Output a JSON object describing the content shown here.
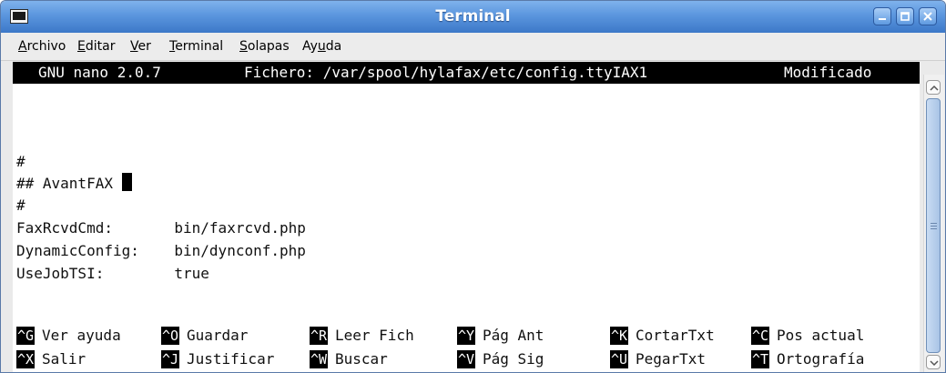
{
  "window": {
    "title": "Terminal",
    "icons": {
      "app": "terminal-icon",
      "minimize": "minimize-icon",
      "maximize": "maximize-icon",
      "close": "close-icon"
    }
  },
  "menubar": {
    "items": [
      {
        "label": "Archivo",
        "mnemonic": "A"
      },
      {
        "label": "Editar",
        "mnemonic": "E"
      },
      {
        "label": "Ver",
        "mnemonic": "V"
      },
      {
        "label": "Terminal",
        "mnemonic": "T"
      },
      {
        "label": "Solapas",
        "mnemonic": "S"
      },
      {
        "label": "Ayuda",
        "mnemonic": "u"
      }
    ]
  },
  "nano": {
    "version": "GNU nano 2.0.7",
    "file": "Fichero: /var/spool/hylafax/etc/config.ttyIAX1",
    "status": "Modificado"
  },
  "editor": {
    "lines": [
      "#",
      "## AvantFAX ",
      "#",
      "FaxRcvdCmd:       bin/faxrcvd.php",
      "DynamicConfig:    bin/dynconf.php",
      "UseJobTSI:        true"
    ]
  },
  "shortcuts": {
    "row1": [
      {
        "key": "^G",
        "label": "Ver ayuda"
      },
      {
        "key": "^O",
        "label": "Guardar"
      },
      {
        "key": "^R",
        "label": "Leer Fich"
      },
      {
        "key": "^Y",
        "label": "Pág Ant"
      },
      {
        "key": "^K",
        "label": "CortarTxt"
      },
      {
        "key": "^C",
        "label": "Pos actual"
      }
    ],
    "row2": [
      {
        "key": "^X",
        "label": "Salir"
      },
      {
        "key": "^J",
        "label": "Justificar"
      },
      {
        "key": "^W",
        "label": "Buscar"
      },
      {
        "key": "^V",
        "label": "Pág Sig"
      },
      {
        "key": "^U",
        "label": "PegarTxt"
      },
      {
        "key": "^T",
        "label": "Ortografía"
      }
    ]
  },
  "colors": {
    "titlebar": "#4f8ad8",
    "status_bg": "#000000",
    "terminal_bg": "#ffffff"
  }
}
